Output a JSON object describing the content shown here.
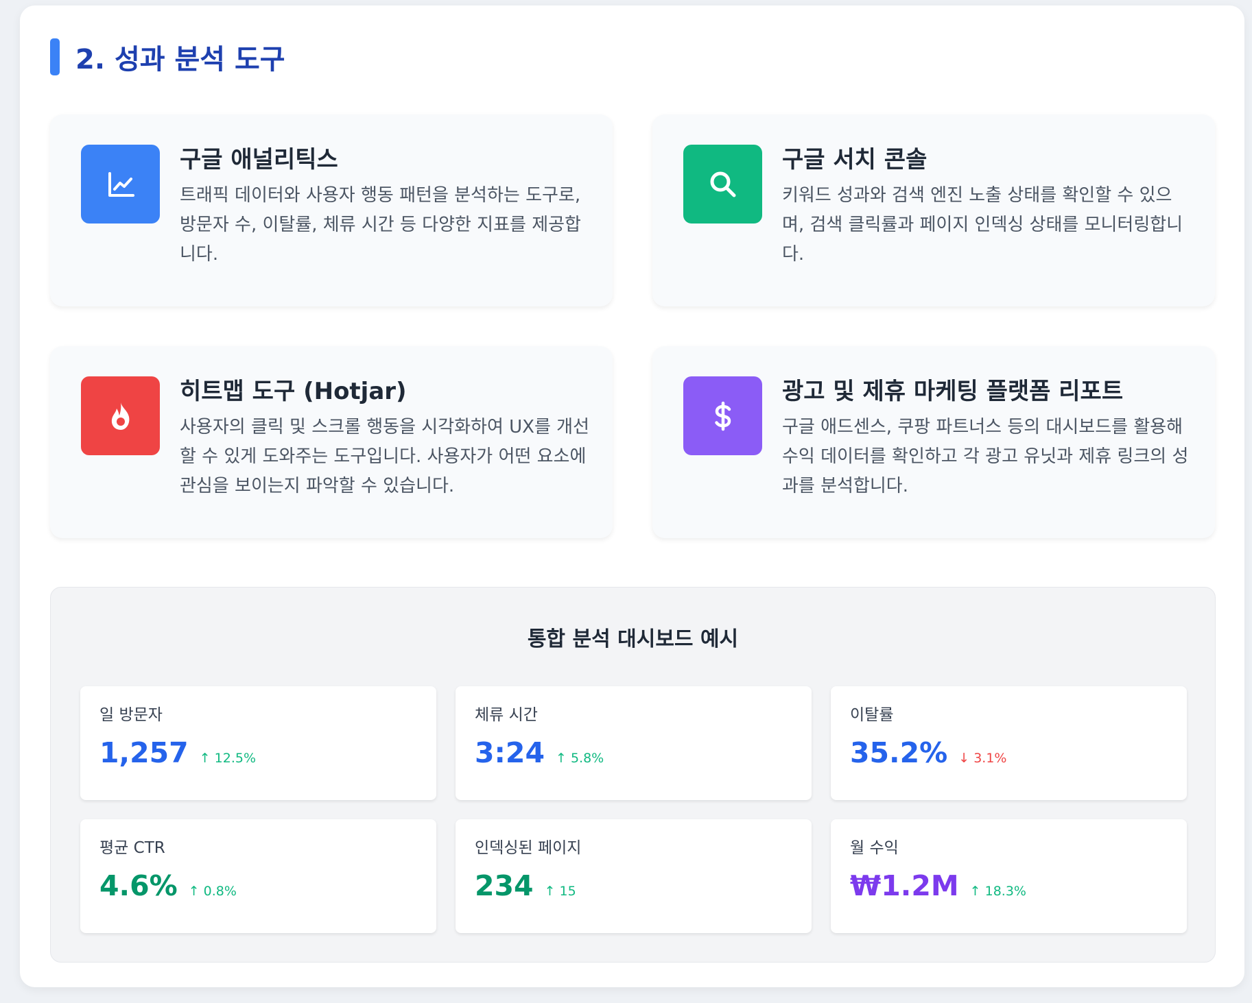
{
  "section": {
    "title": "2. 성과 분석 도구"
  },
  "tools": [
    {
      "name": "구글 애널리틱스",
      "description": "트래픽 데이터와 사용자 행동 패턴을 분석하는 도구로, 방문자 수, 이탈률, 체류 시간 등 다양한 지표를 제공합니다.",
      "icon": "line-chart-icon",
      "color": "#3b82f6"
    },
    {
      "name": "구글 서치 콘솔",
      "description": "키워드 성과와 검색 엔진 노출 상태를 확인할 수 있으며, 검색 클릭률과 페이지 인덱싱 상태를 모니터링합니다.",
      "icon": "search-icon",
      "color": "#10b981"
    },
    {
      "name": "히트맵 도구 (Hotjar)",
      "description": "사용자의 클릭 및 스크롤 행동을 시각화하여 UX를 개선할 수 있게 도와주는 도구입니다. 사용자가 어떤 요소에 관심을 보이는지 파악할 수 있습니다.",
      "icon": "fire-icon",
      "color": "#ef4444"
    },
    {
      "name": "광고 및 제휴 마케팅 플랫폼 리포트",
      "description": "구글 애드센스, 쿠팡 파트너스 등의 대시보드를 활용해 수익 데이터를 확인하고 각 광고 유닛과 제휴 링크의 성과를 분석합니다.",
      "icon": "dollar-icon",
      "color": "#8b5cf6"
    }
  ],
  "dashboard": {
    "title": "통합 분석 대시보드 예시",
    "metrics": [
      {
        "label": "일 방문자",
        "value": "1,257",
        "change": "↑ 12.5%",
        "value_color": "#2563eb",
        "trend": "up"
      },
      {
        "label": "체류 시간",
        "value": "3:24",
        "change": "↑ 5.8%",
        "value_color": "#2563eb",
        "trend": "up"
      },
      {
        "label": "이탈률",
        "value": "35.2%",
        "change": "↓ 3.1%",
        "value_color": "#2563eb",
        "trend": "down"
      },
      {
        "label": "평균 CTR",
        "value": "4.6%",
        "change": "↑ 0.8%",
        "value_color": "#059669",
        "trend": "up"
      },
      {
        "label": "인덱싱된 페이지",
        "value": "234",
        "change": "↑ 15",
        "value_color": "#059669",
        "trend": "up"
      },
      {
        "label": "월 수익",
        "value": "₩1.2M",
        "change": "↑ 18.3%",
        "value_color": "#7c3aed",
        "trend": "up"
      }
    ]
  }
}
